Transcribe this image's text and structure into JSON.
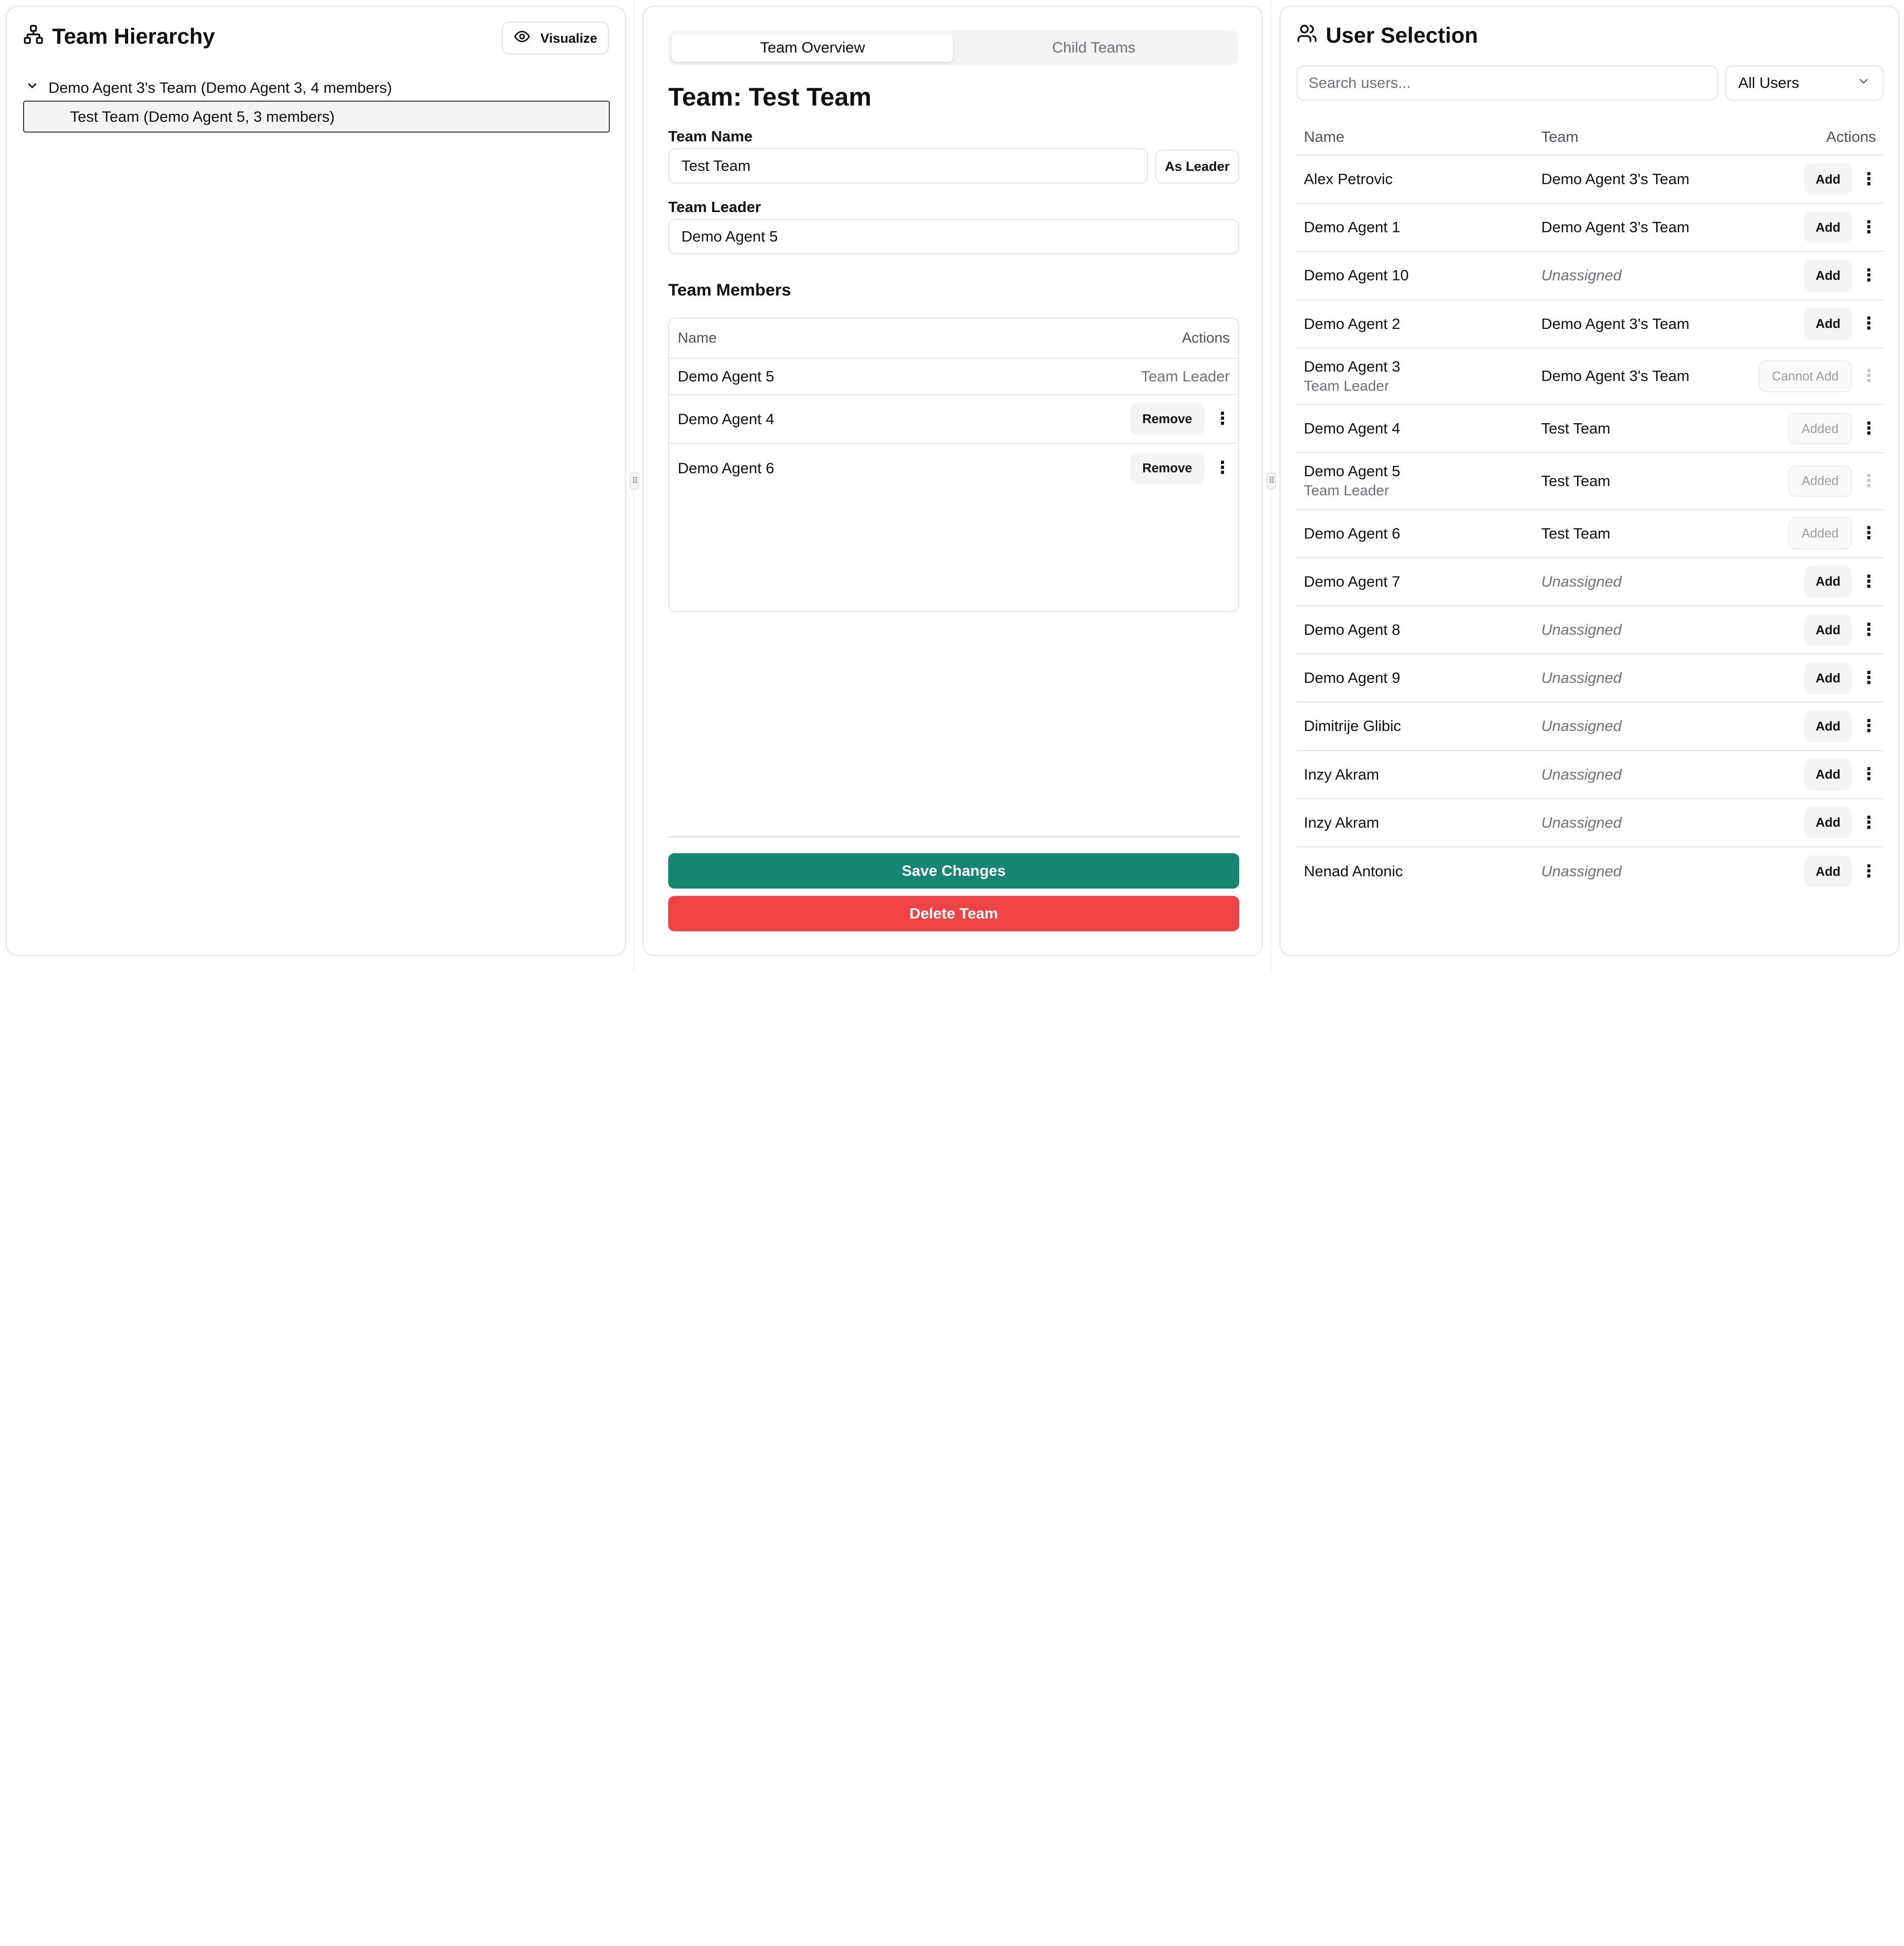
{
  "hierarchy": {
    "title": "Team Hierarchy",
    "visualize_label": "Visualize",
    "root_label": "Demo Agent 3's Team (Demo Agent 3, 4 members)",
    "child_label": "Test Team (Demo Agent 5, 3 members)"
  },
  "overview": {
    "tabs": [
      "Team Overview",
      "Child Teams"
    ],
    "active_tab": "Team Overview",
    "title": "Team: Test Team",
    "team_name_label": "Team Name",
    "team_name_value": "Test Team",
    "as_leader_label": "As Leader",
    "team_leader_label": "Team Leader",
    "team_leader_value": "Demo Agent 5",
    "members_title": "Team Members",
    "members_headers": {
      "name": "Name",
      "actions": "Actions"
    },
    "members": [
      {
        "name": "Demo Agent 5",
        "role": "Team Leader"
      },
      {
        "name": "Demo Agent 4",
        "action": "Remove"
      },
      {
        "name": "Demo Agent 6",
        "action": "Remove"
      }
    ],
    "save_label": "Save Changes",
    "delete_label": "Delete Team"
  },
  "user_selection": {
    "title": "User Selection",
    "search_placeholder": "Search users...",
    "filter_value": "All Users",
    "headers": {
      "name": "Name",
      "team": "Team",
      "actions": "Actions"
    },
    "users": [
      {
        "name": "Alex Petrovic",
        "team": "Demo Agent 3's Team",
        "action": "Add"
      },
      {
        "name": "Demo Agent 1",
        "team": "Demo Agent 3's Team",
        "action": "Add"
      },
      {
        "name": "Demo Agent 10",
        "team": "Unassigned",
        "action": "Add"
      },
      {
        "name": "Demo Agent 2",
        "team": "Demo Agent 3's Team",
        "action": "Add"
      },
      {
        "name": "Demo Agent 3",
        "sub": "Team Leader",
        "team": "Demo Agent 3's Team",
        "action": "Cannot Add"
      },
      {
        "name": "Demo Agent 4",
        "team": "Test Team",
        "action": "Added"
      },
      {
        "name": "Demo Agent 5",
        "sub": "Team Leader",
        "team": "Test Team",
        "action": "Added"
      },
      {
        "name": "Demo Agent 6",
        "team": "Test Team",
        "action": "Added"
      },
      {
        "name": "Demo Agent 7",
        "team": "Unassigned",
        "action": "Add"
      },
      {
        "name": "Demo Agent 8",
        "team": "Unassigned",
        "action": "Add"
      },
      {
        "name": "Demo Agent 9",
        "team": "Unassigned",
        "action": "Add"
      },
      {
        "name": "Dimitrije Glibic",
        "team": "Unassigned",
        "action": "Add"
      },
      {
        "name": "Inzy Akram",
        "team": "Unassigned",
        "action": "Add"
      },
      {
        "name": "Inzy Akram",
        "team": "Unassigned",
        "action": "Add"
      },
      {
        "name": "Nenad Antonic",
        "team": "Unassigned",
        "action": "Add"
      }
    ]
  },
  "colors": {
    "save": "#178670",
    "delete": "#ef4444"
  }
}
